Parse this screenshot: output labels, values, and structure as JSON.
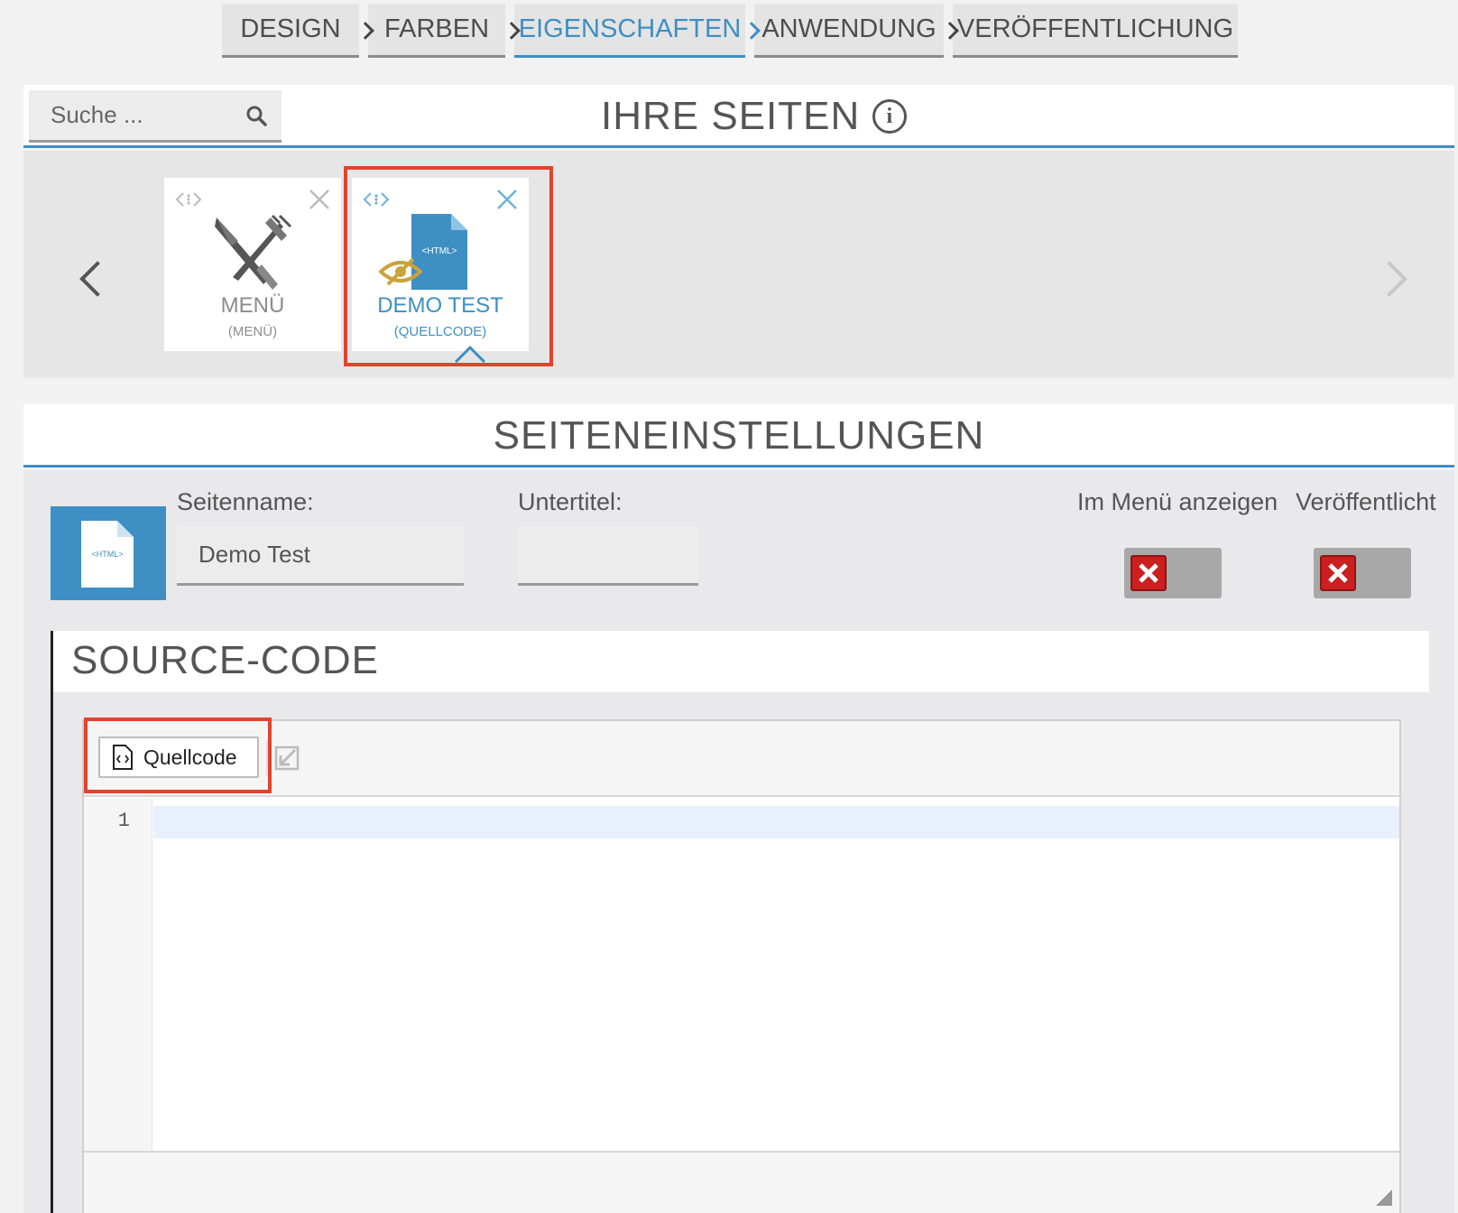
{
  "wizard": {
    "steps": [
      {
        "label": "DESIGN",
        "active": false
      },
      {
        "label": "FARBEN",
        "active": false
      },
      {
        "label": "EIGENSCHAFTEN",
        "active": true
      },
      {
        "label": "ANWENDUNG",
        "active": false
      },
      {
        "label": "VERÖFFENTLICHUNG",
        "active": false
      }
    ]
  },
  "pages": {
    "search_placeholder": "Suche ...",
    "title": "IHRE SEITEN",
    "info_icon": "i",
    "tiles": [
      {
        "name": "MENÜ",
        "type": "(MENÜ)",
        "icon": "cutlery-icon"
      },
      {
        "name": "DEMO TEST",
        "type": "(QUELLCODE)",
        "icon": "html-file-icon",
        "hidden_indicator": "eye-slash-icon",
        "selected": true
      }
    ]
  },
  "settings": {
    "title": "SEITENEINSTELLUNGEN",
    "page_icon_text": "<HTML>",
    "page_name_label": "Seitenname:",
    "page_name_value": "Demo Test",
    "subtitle_label": "Untertitel:",
    "subtitle_value": "",
    "show_in_menu_label": "Im Menü anzeigen",
    "show_in_menu": false,
    "published_label": "Veröffentlicht",
    "published": false
  },
  "source": {
    "title": "SOURCE-CODE",
    "button_label": "Quellcode",
    "line_numbers": [
      "1"
    ]
  },
  "colors": {
    "accent": "#3d8fc4",
    "highlight": "#e2432e",
    "toggle_off": "#cc1f1f",
    "hidden_eye": "#c9a43a"
  }
}
